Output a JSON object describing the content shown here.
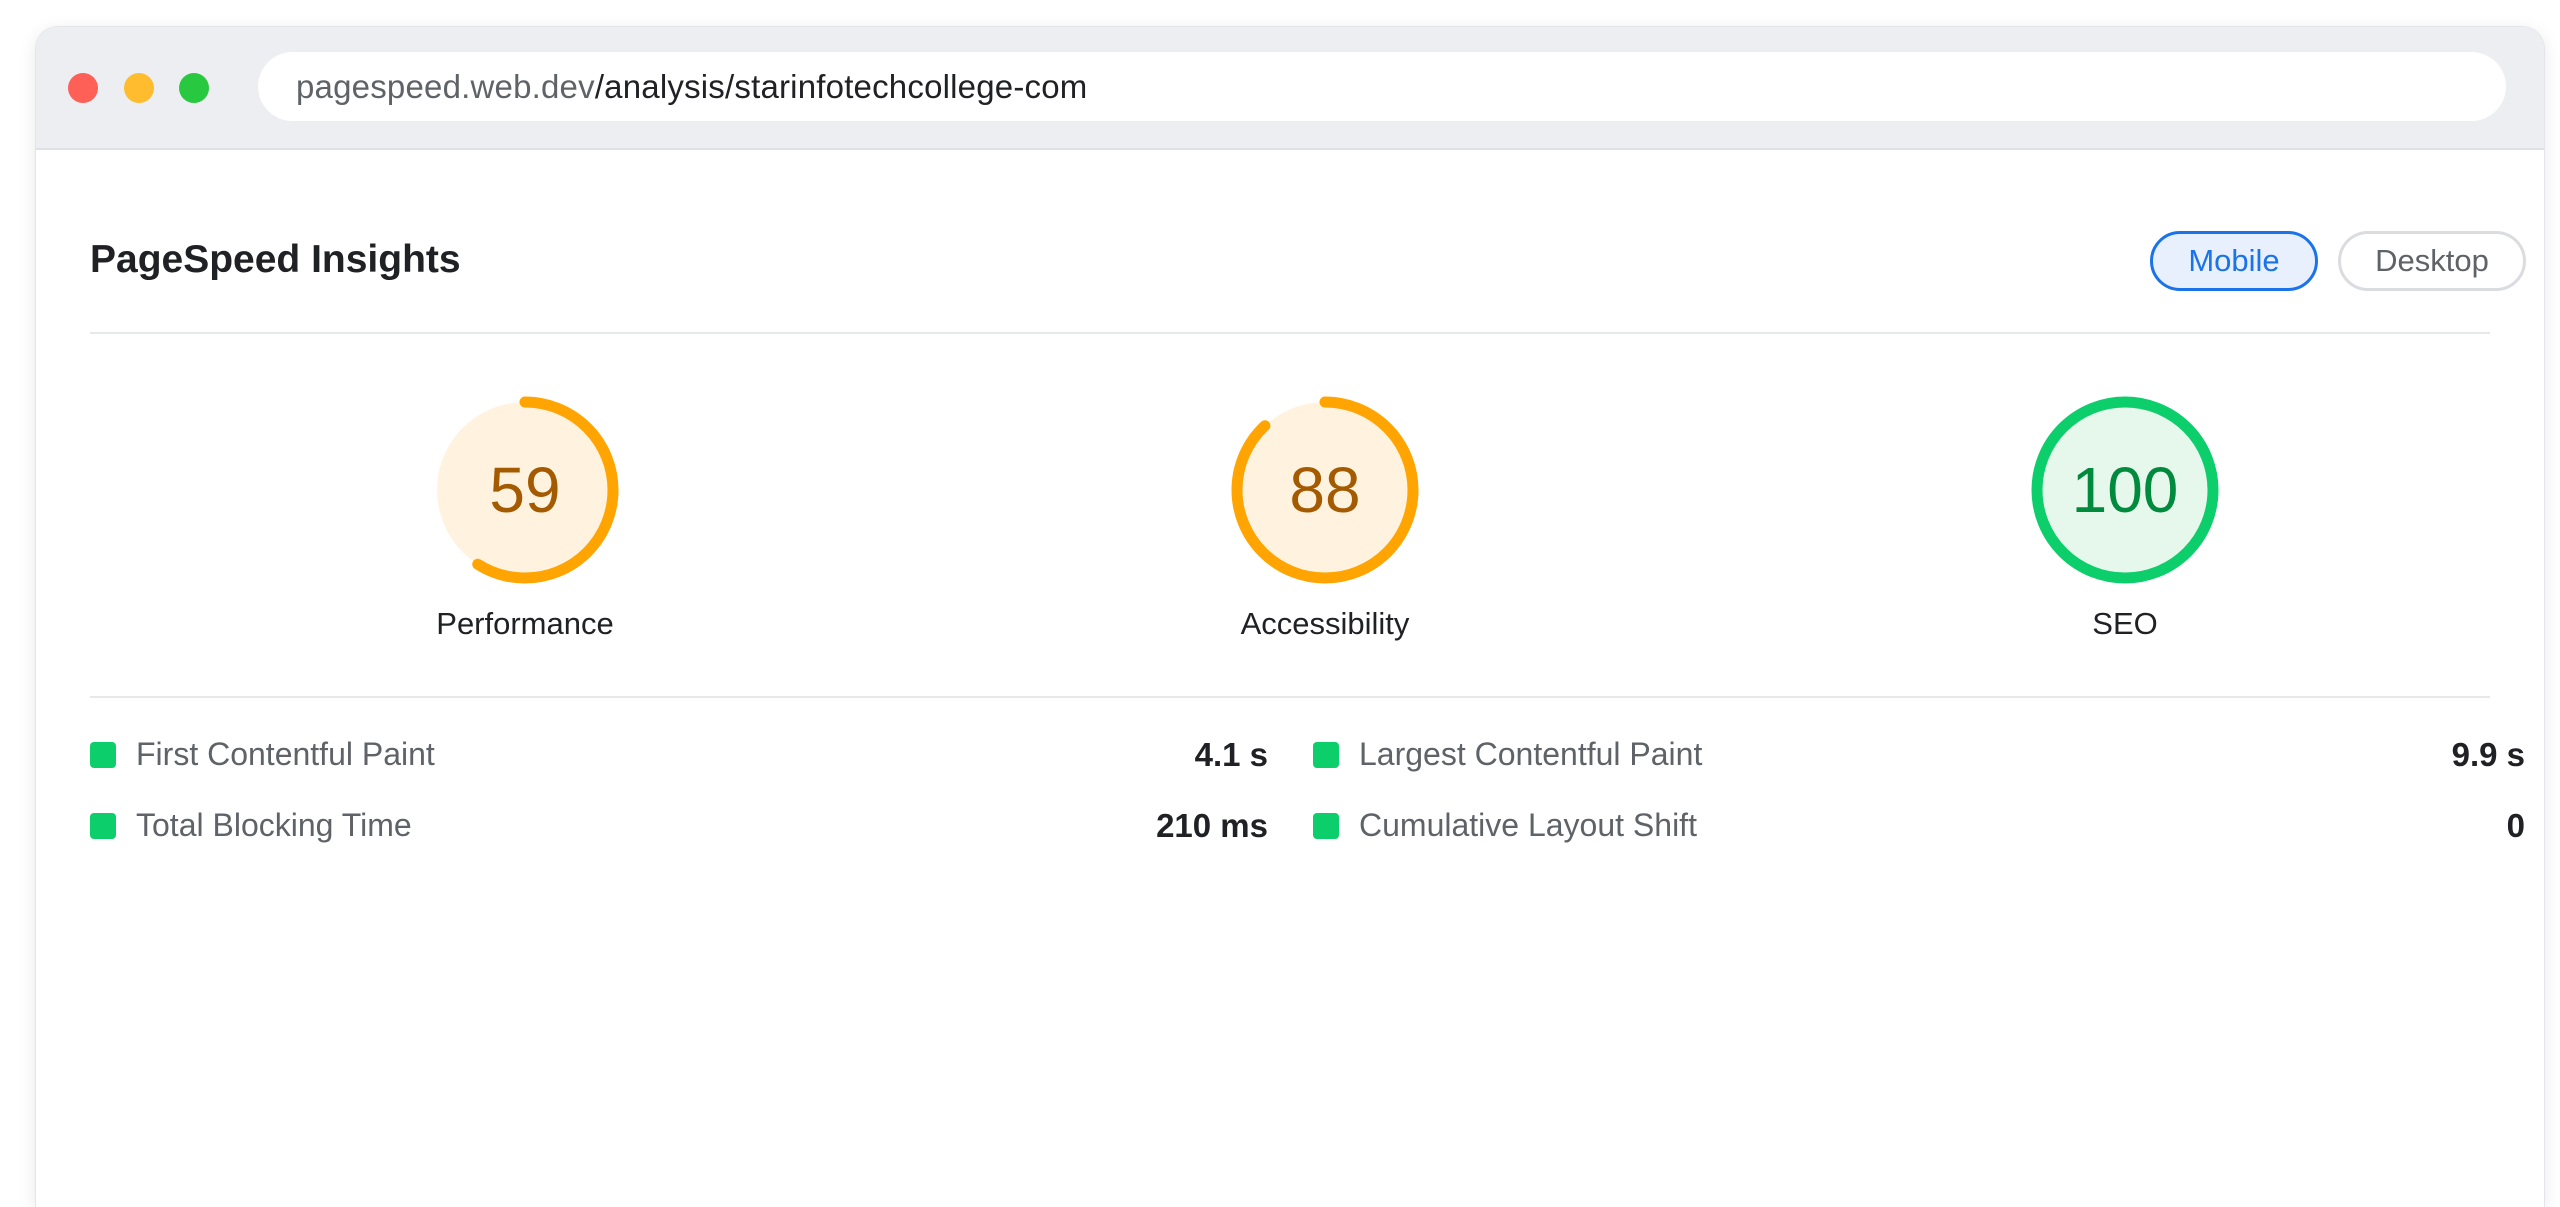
{
  "browser": {
    "url_domain": "pagespeed.web.dev",
    "url_path": "/analysis/starinfotechcollege-com"
  },
  "header": {
    "title": "PageSpeed Insights",
    "mobile_label": "Mobile",
    "desktop_label": "Desktop",
    "selected": "Mobile"
  },
  "scores": [
    {
      "label": "Performance",
      "value": "59",
      "fraction": 0.59,
      "color": "#ffa400",
      "fill": "#fff3e0",
      "text_color": "#a35a00"
    },
    {
      "label": "Accessibility",
      "value": "88",
      "fraction": 0.88,
      "color": "#ffa400",
      "fill": "#fff3e0",
      "text_color": "#a35a00"
    },
    {
      "label": "SEO",
      "value": "100",
      "fraction": 1.0,
      "color": "#0cce6b",
      "fill": "#e6f7ec",
      "text_color": "#008a3e"
    }
  ],
  "metrics": [
    {
      "name": "First Contentful Paint",
      "value": "4.1 s",
      "status_color": "#0cce6b"
    },
    {
      "name": "Largest Contentful Paint",
      "value": "9.9 s",
      "status_color": "#0cce6b"
    },
    {
      "name": "Total Blocking Time",
      "value": "210 ms",
      "status_color": "#0cce6b"
    },
    {
      "name": "Cumulative Layout Shift",
      "value": "0",
      "status_color": "#0cce6b"
    }
  ],
  "colors": {
    "accent": "#1a73e8",
    "good": "#0cce6b",
    "average": "#ffa400"
  }
}
